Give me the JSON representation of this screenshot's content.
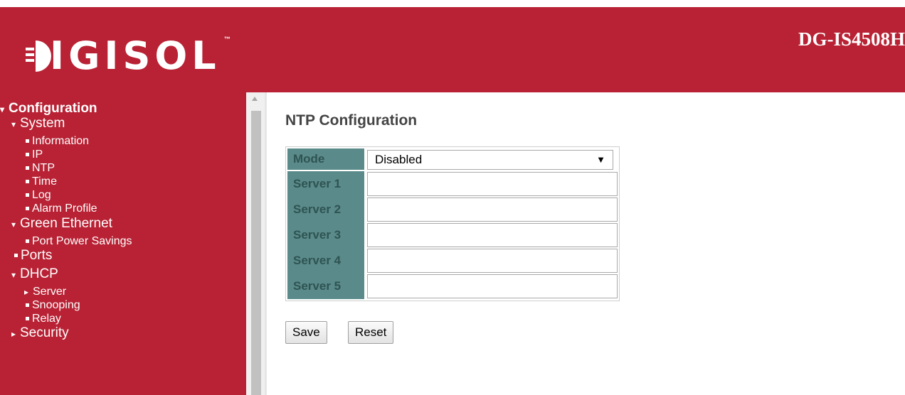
{
  "header": {
    "logo_text": "IGISOL",
    "logo_tm": "™",
    "model": "DG-IS4508H"
  },
  "sidebar": {
    "items": [
      {
        "label": "Configuration",
        "marker": "▾"
      },
      {
        "label": "System",
        "marker": "▾"
      },
      {
        "label": "Information"
      },
      {
        "label": "IP"
      },
      {
        "label": "NTP"
      },
      {
        "label": "Time"
      },
      {
        "label": "Log"
      },
      {
        "label": "Alarm Profile"
      },
      {
        "label": "Green Ethernet",
        "marker": "▾"
      },
      {
        "label": "Port Power Savings"
      },
      {
        "label": "Ports"
      },
      {
        "label": "DHCP",
        "marker": "▾"
      },
      {
        "label": "Server",
        "marker": "▸"
      },
      {
        "label": "Snooping"
      },
      {
        "label": "Relay"
      },
      {
        "label": "Security",
        "marker": "▸"
      }
    ]
  },
  "page": {
    "title": "NTP Configuration",
    "mode_label": "Mode",
    "mode_value": "Disabled",
    "mode_arrow": "▼",
    "servers": [
      {
        "label": "Server 1",
        "value": ""
      },
      {
        "label": "Server 2",
        "value": ""
      },
      {
        "label": "Server 3",
        "value": ""
      },
      {
        "label": "Server 4",
        "value": ""
      },
      {
        "label": "Server 5",
        "value": ""
      }
    ],
    "save_label": "Save",
    "reset_label": "Reset"
  },
  "colors": {
    "brand": "#b82234",
    "table_label_bg": "#5a8a8a"
  }
}
